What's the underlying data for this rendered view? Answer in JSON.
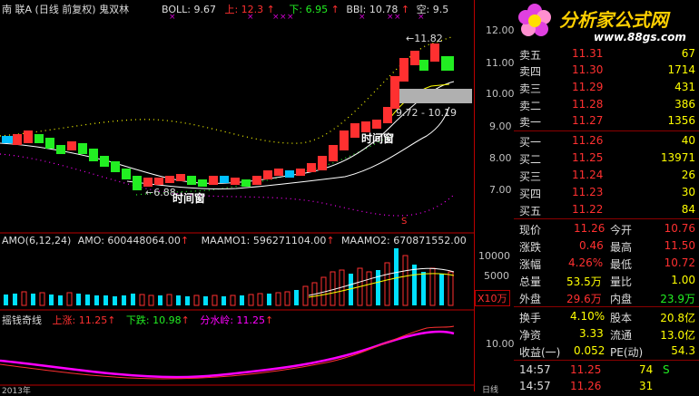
{
  "header": {
    "title_prefix": "南  ",
    "title": "联A (日线 前复权) 鬼双林",
    "boll": "BOLL: 9.67",
    "up": "上: 12.3",
    "down": "下: 6.95",
    "bbi": "BBI: 10.78",
    "kong": "空: 9.5"
  },
  "price_axis": [
    "12.00",
    "11.00",
    "10.00",
    "9.00",
    "8.00",
    "7.00"
  ],
  "chart_labels": {
    "high": "11.82",
    "low": "6.88",
    "range": "9.72 - 10.19",
    "time_window1": "时间窗",
    "time_window2": "时间窗",
    "s_marker": "S"
  },
  "amo": {
    "title": "AMO(6,12,24)",
    "amo": "AMO: 600448064.00",
    "maamo1": "MAAMO1: 596271104.00",
    "maamo2": "MAAMO2: 670871552.00",
    "axis": [
      "10000",
      "5000"
    ],
    "unit": "X10万"
  },
  "yq": {
    "title": "摇钱奇线",
    "up": "上涨: 11.25",
    "down": "下跌: 10.98",
    "fen": "分水岭: 11.25",
    "axis": "10.00",
    "xaxis_left": "2013年",
    "xaxis_right": "日线"
  },
  "logo": {
    "title": "分析家公式网",
    "url": "www.88gs.com",
    "colors": {
      "title": "#ffd000",
      "url": "#ffffff"
    }
  },
  "asks": [
    {
      "label": "卖五",
      "price": "11.31",
      "vol": "67"
    },
    {
      "label": "卖四",
      "price": "11.30",
      "vol": "1714"
    },
    {
      "label": "卖三",
      "price": "11.29",
      "vol": "431"
    },
    {
      "label": "卖二",
      "price": "11.28",
      "vol": "386"
    },
    {
      "label": "卖一",
      "price": "11.27",
      "vol": "1356"
    }
  ],
  "bids": [
    {
      "label": "买一",
      "price": "11.26",
      "vol": "40"
    },
    {
      "label": "买二",
      "price": "11.25",
      "vol": "13971"
    },
    {
      "label": "买三",
      "price": "11.24",
      "vol": "26"
    },
    {
      "label": "买四",
      "price": "11.23",
      "vol": "30"
    },
    {
      "label": "买五",
      "price": "11.22",
      "vol": "84"
    }
  ],
  "stats": [
    {
      "l1": "现价",
      "v1": "11.26",
      "l2": "今开",
      "v2": "10.76"
    },
    {
      "l1": "涨跌",
      "v1": "0.46",
      "l2": "最高",
      "v2": "11.50"
    },
    {
      "l1": "涨幅",
      "v1": "4.26%",
      "l2": "最低",
      "v2": "10.72"
    },
    {
      "l1": "总量",
      "v1": "53.5万",
      "l2": "量比",
      "v2": "1.00"
    },
    {
      "l1": "外盘",
      "v1": "29.6万",
      "l2": "内盘",
      "v2": "23.9万"
    }
  ],
  "stats2": [
    {
      "l1": "换手",
      "v1": "4.10%",
      "l2": "股本",
      "v2": "20.8亿"
    },
    {
      "l1": "净资",
      "v1": "3.33",
      "l2": "流通",
      "v2": "13.0亿"
    },
    {
      "l1": "收益(一)",
      "v1": "0.052",
      "l2": "PE(动)",
      "v2": "54.3"
    }
  ],
  "ticks": [
    {
      "time": "14:57",
      "price": "11.25",
      "vol": "74",
      "flag": "S"
    },
    {
      "time": "14:57",
      "price": "11.26",
      "vol": "31",
      "flag": ""
    }
  ]
}
